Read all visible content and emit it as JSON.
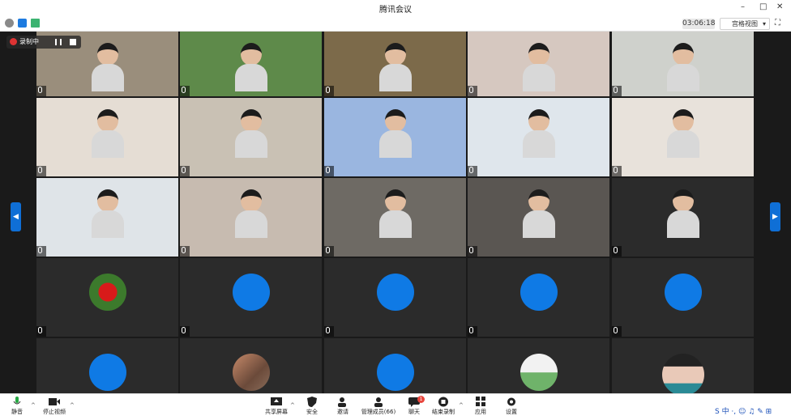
{
  "window": {
    "title": "腾讯会议",
    "minimize_label": "–",
    "maximize_label": "□",
    "close_label": "✕"
  },
  "infobar": {
    "timer": "03:06:18",
    "view_mode": "宫格视图",
    "view_mode_arrow": "▾",
    "fullscreen_label": "⛶"
  },
  "recording": {
    "label": "录制中"
  },
  "nav": {
    "prev_label": "◀",
    "next_label": "▶"
  },
  "tiles": [
    {
      "name": "",
      "kind": "video",
      "bg": "#9a8e7c"
    },
    {
      "name": "",
      "kind": "video",
      "bg": "#5e8a4a"
    },
    {
      "name": "",
      "kind": "video",
      "bg": "#7c6a4a"
    },
    {
      "name": "",
      "kind": "video",
      "bg": "#d6c8c0"
    },
    {
      "name": "",
      "kind": "video",
      "bg": "#cfd1cc"
    },
    {
      "name": "",
      "kind": "video",
      "bg": "#e5ddd4"
    },
    {
      "name": "",
      "kind": "video",
      "bg": "#c9c1b4"
    },
    {
      "name": "",
      "kind": "video",
      "bg": "#9ab6e0"
    },
    {
      "name": "",
      "kind": "video",
      "bg": "#dfe6ec"
    },
    {
      "name": "",
      "kind": "video",
      "bg": "#e8e2db"
    },
    {
      "name": "",
      "kind": "video",
      "bg": "#dfe4e8"
    },
    {
      "name": "",
      "kind": "video",
      "bg": "#c7bbb0"
    },
    {
      "name": "",
      "kind": "video",
      "bg": "#6e6a64"
    },
    {
      "name": "",
      "kind": "video",
      "bg": "#5a5652"
    },
    {
      "name": "",
      "kind": "video",
      "bg": "#2b2b2b"
    },
    {
      "name": "",
      "kind": "avatar",
      "initial": "",
      "style": "img-rose"
    },
    {
      "name": "",
      "kind": "avatar",
      "initial": "",
      "style": ""
    },
    {
      "name": "",
      "kind": "avatar",
      "initial": "",
      "style": ""
    },
    {
      "name": "",
      "kind": "avatar",
      "initial": "",
      "style": ""
    },
    {
      "name": "",
      "kind": "avatar",
      "initial": "",
      "style": ""
    },
    {
      "name": "",
      "kind": "avatar",
      "initial": "",
      "style": ""
    },
    {
      "name": "",
      "kind": "avatar",
      "initial": "",
      "style": "img-rail"
    },
    {
      "name": "",
      "kind": "avatar",
      "initial": "",
      "style": ""
    },
    {
      "name": "",
      "kind": "avatar",
      "initial": "",
      "style": "img-cartoon"
    },
    {
      "name": "",
      "kind": "avatar",
      "initial": "",
      "style": "img-anime"
    }
  ],
  "toolbar": {
    "mute": "静音",
    "stop_video": "停止视频",
    "share": "共享屏幕",
    "security": "安全",
    "invite": "邀请",
    "members": "管理成员(66)",
    "chat": "聊天",
    "chat_badge": "1",
    "record": "结束录制",
    "apps": "应用",
    "settings": "设置",
    "caret": "^"
  },
  "speaking": {
    "label": ""
  },
  "ime": {
    "text": "S 中 ·, ☺ ♫ ✎ ⊞"
  },
  "colors": {
    "accent": "#0f6fd6",
    "avatar_blue": "#0f7ae5",
    "stage_bg": "#1a1a1a",
    "record_red": "#d33333"
  }
}
